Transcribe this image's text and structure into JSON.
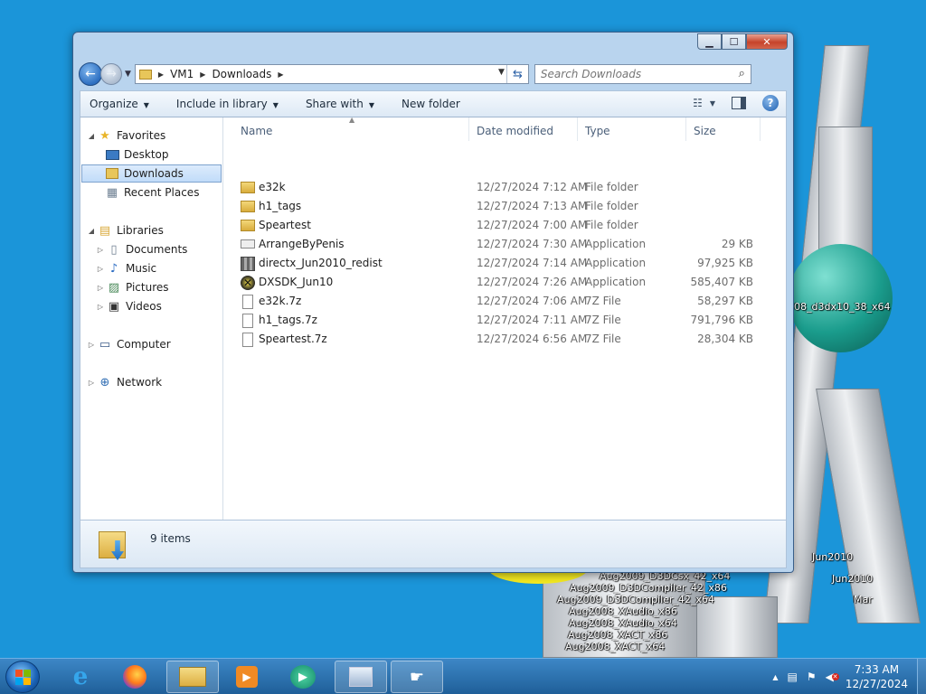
{
  "window": {
    "caption_buttons": {
      "minimize": "▁",
      "maximize": "☐",
      "close": "✕"
    },
    "breadcrumb": [
      "VM1",
      "Downloads"
    ],
    "search_placeholder": "Search Downloads"
  },
  "toolbar": {
    "organize": "Organize",
    "include_in_library": "Include in library",
    "share_with": "Share with",
    "new_folder": "New folder"
  },
  "navpane": {
    "favorites": "Favorites",
    "desktop": "Desktop",
    "downloads": "Downloads",
    "recent_places": "Recent Places",
    "libraries": "Libraries",
    "documents": "Documents",
    "music": "Music",
    "pictures": "Pictures",
    "videos": "Videos",
    "computer": "Computer",
    "network": "Network"
  },
  "columns": {
    "name": "Name",
    "date": "Date modified",
    "type": "Type",
    "size": "Size"
  },
  "files": [
    {
      "name": "e32k",
      "date": "12/27/2024 7:12 AM",
      "type": "File folder",
      "size": "",
      "icon": "folder-icon"
    },
    {
      "name": "h1_tags",
      "date": "12/27/2024 7:13 AM",
      "type": "File folder",
      "size": "",
      "icon": "folder-icon"
    },
    {
      "name": "Speartest",
      "date": "12/27/2024 7:00 AM",
      "type": "File folder",
      "size": "",
      "icon": "folder-icon"
    },
    {
      "name": "ArrangeByPenis",
      "date": "12/27/2024 7:30 AM",
      "type": "Application",
      "size": "29 KB",
      "icon": "app-icon"
    },
    {
      "name": "directx_Jun2010_redist",
      "date": "12/27/2024 7:14 AM",
      "type": "Application",
      "size": "97,925 KB",
      "icon": "installer-icon"
    },
    {
      "name": "DXSDK_Jun10",
      "date": "12/27/2024 7:26 AM",
      "type": "Application",
      "size": "585,407 KB",
      "icon": "directx-icon"
    },
    {
      "name": "e32k.7z",
      "date": "12/27/2024 7:06 AM",
      "type": "7Z File",
      "size": "58,297 KB",
      "icon": "file-icon"
    },
    {
      "name": "h1_tags.7z",
      "date": "12/27/2024 7:11 AM",
      "type": "7Z File",
      "size": "791,796 KB",
      "icon": "file-icon"
    },
    {
      "name": "Speartest.7z",
      "date": "12/27/2024 6:56 AM",
      "type": "7Z File",
      "size": "28,304 KB",
      "icon": "file-icon"
    }
  ],
  "details": {
    "item_count": "9 items"
  },
  "desktop_labels": [
    "08_d3dx10_38_x64",
    "Aug2009_D3DCsx_42_x64",
    "Aug2009_D3DCompiler_42_x86",
    "Aug2009_D3DCompiler_42_x64",
    "Aug2008_XAudio_x86",
    "Aug2008_XAudio_x64",
    "Aug2008_XACT_x86",
    "Aug2008_XACT_x64",
    "Jun2010",
    "Jun2010",
    "Mar"
  ],
  "taskbar": {
    "clock_time": "7:33 AM",
    "clock_date": "12/27/2024"
  }
}
